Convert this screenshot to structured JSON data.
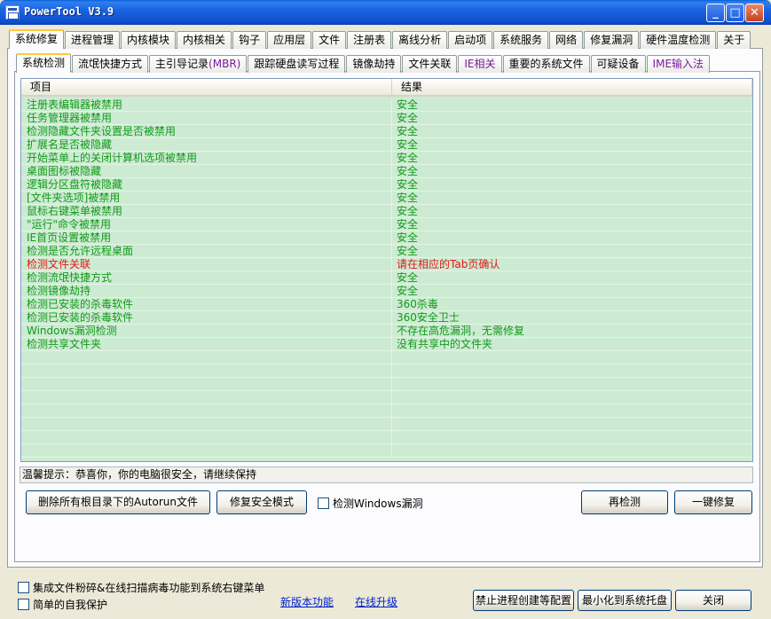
{
  "window": {
    "title": "PowerTool V3.9"
  },
  "title_buttons": {
    "minimize": "_",
    "maximize": "□",
    "close": "✕"
  },
  "main_tabs": [
    "系统修复",
    "进程管理",
    "内核模块",
    "内核相关",
    "钩子",
    "应用层",
    "文件",
    "注册表",
    "离线分析",
    "启动项",
    "系统服务",
    "网络",
    "修复漏洞",
    "硬件温度检测",
    "关于"
  ],
  "sub_tabs": [
    "系统检测",
    "流氓快捷方式",
    "主引导记录",
    "(MBR)",
    "跟踪硬盘读写过程",
    "镜像劫持",
    "文件关联",
    "IE相关",
    "重要的系统文件",
    "可疑设备",
    "IME输入法"
  ],
  "table": {
    "columns": [
      "项目",
      "结果"
    ],
    "rows": [
      {
        "item": "注册表编辑器被禁用",
        "result": "安全",
        "status": "ok"
      },
      {
        "item": "任务管理器被禁用",
        "result": "安全",
        "status": "ok"
      },
      {
        "item": "检测隐藏文件夹设置是否被禁用",
        "result": "安全",
        "status": "ok"
      },
      {
        "item": "扩展名是否被隐藏",
        "result": "安全",
        "status": "ok"
      },
      {
        "item": "开始菜单上的关闭计算机选项被禁用",
        "result": "安全",
        "status": "ok"
      },
      {
        "item": "桌面图标被隐藏",
        "result": "安全",
        "status": "ok"
      },
      {
        "item": "逻辑分区盘符被隐藏",
        "result": "安全",
        "status": "ok"
      },
      {
        "item": "[文件夹选项]被禁用",
        "result": "安全",
        "status": "ok"
      },
      {
        "item": "鼠标右键菜单被禁用",
        "result": "安全",
        "status": "ok"
      },
      {
        "item": "\"运行\"命令被禁用",
        "result": "安全",
        "status": "ok"
      },
      {
        "item": "IE首页设置被禁用",
        "result": "安全",
        "status": "ok"
      },
      {
        "item": "检测是否允许远程桌面",
        "result": "安全",
        "status": "ok"
      },
      {
        "item": "检测文件关联",
        "result": "请在相应的Tab页确认",
        "status": "bad"
      },
      {
        "item": "检测流氓快捷方式",
        "result": "安全",
        "status": "ok"
      },
      {
        "item": "检测镜像劫持",
        "result": "安全",
        "status": "ok"
      },
      {
        "item": "检测已安装的杀毒软件",
        "result": "360杀毒",
        "status": "ok"
      },
      {
        "item": "检测已安装的杀毒软件",
        "result": "360安全卫士",
        "status": "ok"
      },
      {
        "item": "Windows漏洞检测",
        "result": "不存在高危漏洞，无需修复",
        "status": "ok"
      },
      {
        "item": "检测共享文件夹",
        "result": "没有共享中的文件夹",
        "status": "ok"
      }
    ]
  },
  "status_text": "温馨提示：恭喜你，你的电脑很安全，请继续保持",
  "buttons": {
    "delete_autorun": "删除所有根目录下的Autorun文件",
    "repair_safe_mode": "修复安全模式",
    "recheck": "再检测",
    "one_click_fix": "一键修复",
    "block_process": "禁止进程创建等配置",
    "minimize_tray": "最小化到系统托盘",
    "close": "关闭"
  },
  "checkboxes": {
    "check_windows_vuln": "检测Windows漏洞",
    "integrate_menu": "集成文件粉碎&在线扫描病毒功能到系统右键菜单",
    "self_protect": "简单的自我保护"
  },
  "links": {
    "new_features": "新版本功能",
    "online_upgrade": "在线升级"
  },
  "colors": {
    "safe": "#119a19",
    "warning": "#e01818",
    "table_bg": "#cdebd3",
    "titlebar": "#0d4fd0"
  }
}
